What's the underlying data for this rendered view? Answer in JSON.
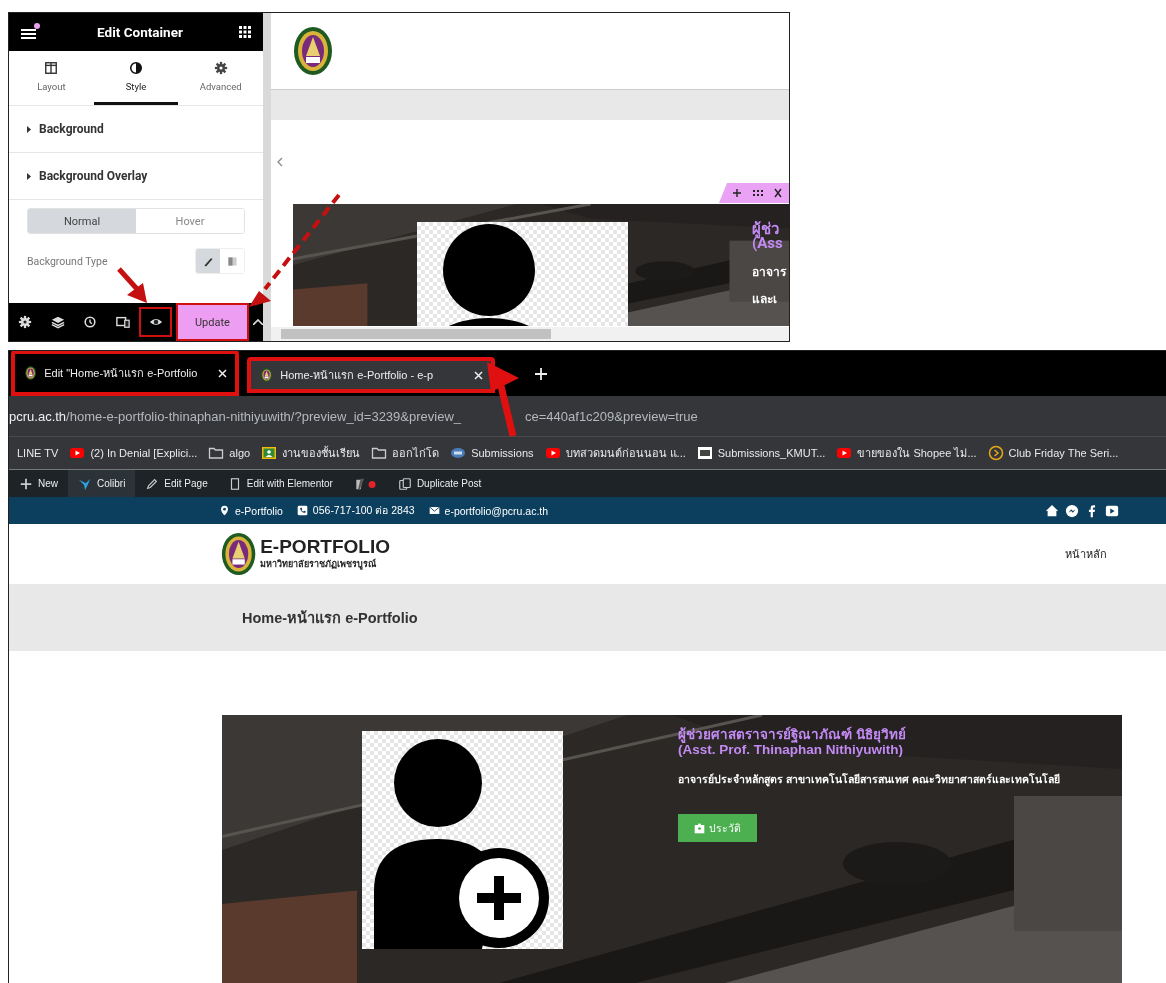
{
  "editor_panel": {
    "title": "Edit Container",
    "tabs": [
      {
        "kind": "layout",
        "label": "Layout",
        "selected": false
      },
      {
        "kind": "style",
        "label": "Style",
        "selected": true
      },
      {
        "kind": "advanced",
        "label": "Advanced",
        "selected": false
      }
    ],
    "sections": [
      "Background",
      "Background Overlay"
    ],
    "state_toggle": [
      {
        "label": "Normal",
        "selected": true
      },
      {
        "label": "Hover",
        "selected": false
      }
    ],
    "background_type": {
      "label": "Background Type",
      "options": [
        {
          "kind": "classic",
          "selected": true
        },
        {
          "kind": "gradient",
          "selected": false
        }
      ]
    },
    "footer_tools": [
      {
        "kind": "settings",
        "highlighted": false
      },
      {
        "kind": "layers",
        "highlighted": false
      },
      {
        "kind": "history",
        "highlighted": false
      },
      {
        "kind": "responsive",
        "highlighted": false
      },
      {
        "kind": "preview",
        "highlighted": true
      }
    ],
    "update_button": {
      "label": "Update",
      "highlighted": true
    }
  },
  "editor_preview": {
    "heading_lines": [
      "ผู้ช่ว",
      "(Ass"
    ],
    "text_lines": [
      "อาจาร",
      "และเ"
    ]
  },
  "browser": {
    "tabs": [
      {
        "title": "Edit \"Home-หน้าแรก e-Portfolio",
        "selected": false,
        "highlighted": true
      },
      {
        "title": "Home-หน้าแรก e-Portfolio - e-p",
        "selected": true,
        "highlighted": true
      }
    ],
    "address": {
      "host": "pcru.ac.th",
      "path_parts": [
        "/home-e-portfolio-thinaphan-nithiyuwith/?preview_id=3239&preview_",
        "ce=440af1c209&preview=true"
      ]
    },
    "bookmarks": [
      {
        "kind": "plain",
        "label": "LINE TV"
      },
      {
        "kind": "youtube",
        "label": "(2) In Denial [Explici..."
      },
      {
        "kind": "folder",
        "label": "algo"
      },
      {
        "kind": "classroom",
        "label": "งานของชั้นเรียน"
      },
      {
        "kind": "folder",
        "label": "ออกไก่โด"
      },
      {
        "kind": "link",
        "label": "Submissions"
      },
      {
        "kind": "youtube",
        "label": "บทสวดมนต์ก่อนนอน แ..."
      },
      {
        "kind": "pkp",
        "label": "Submissions_KMUT..."
      },
      {
        "kind": "youtube",
        "label": "ขายของใน Shopee ไม่..."
      },
      {
        "kind": "play",
        "label": "Club Friday The Seri..."
      }
    ],
    "admin_bar": [
      {
        "kind": "new",
        "label": "New",
        "selected": false
      },
      {
        "kind": "colibri",
        "label": "Colibri",
        "selected": true
      },
      {
        "kind": "edit",
        "label": "Edit Page",
        "selected": false
      },
      {
        "kind": "elementor",
        "label": "Edit with Elementor",
        "selected": false
      },
      {
        "kind": "seo",
        "selected": false
      },
      {
        "kind": "duplicate",
        "label": "Duplicate Post",
        "selected": false
      }
    ]
  },
  "site": {
    "contacts": [
      {
        "kind": "pin",
        "text": "e-Portfolio"
      },
      {
        "kind": "phone",
        "text": "056-717-100 ต่อ 2843"
      },
      {
        "kind": "mail",
        "text": "e-portfolio@pcru.ac.th"
      }
    ],
    "logo_title": "E-PORTFOLIO",
    "logo_subtitle": "มหาวิทยาลัยราชภัฏเพชรบูรณ์",
    "nav": [
      "หน้าหลัก"
    ],
    "page_title": "Home-หน้าแรก e-Portfolio",
    "hero": {
      "name_th": "ผู้ช่วยศาสตราจารย์ฐิณาภัณฑ์ นิธิยุวิทย์",
      "name_en": "(Asst. Prof. Thinaphan Nithiyuwith)",
      "position": "อาจารย์ประจำหลักสูตร สาขาเทคโนโลยีสารสนเทศ คณะวิทยาศาสตร์และเทคโนโลยี",
      "button": "ประวัติ"
    }
  }
}
